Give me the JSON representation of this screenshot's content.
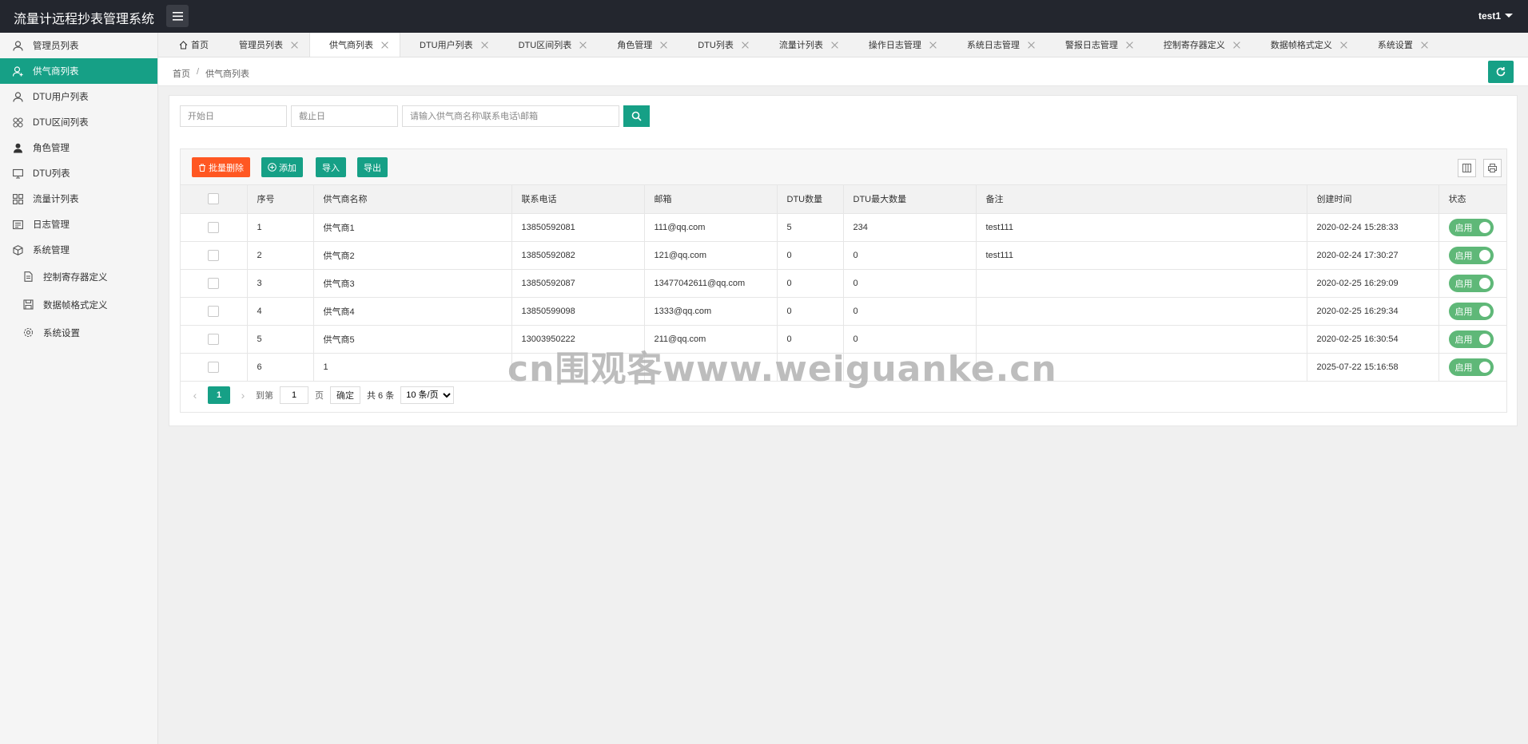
{
  "app": {
    "title": "流量计远程抄表管理系统",
    "user": "test1"
  },
  "sidebar": {
    "items": [
      {
        "label": "管理员列表",
        "icon": "user-icon"
      },
      {
        "label": "供气商列表",
        "icon": "user-add-icon",
        "active": true
      },
      {
        "label": "DTU用户列表",
        "icon": "user-icon"
      },
      {
        "label": "DTU区间列表",
        "icon": "grid-circles-icon"
      },
      {
        "label": "角色管理",
        "icon": "user-solid-icon"
      },
      {
        "label": "DTU列表",
        "icon": "monitor-icon"
      },
      {
        "label": "流量计列表",
        "icon": "apps-icon"
      },
      {
        "label": "日志管理",
        "icon": "log-icon"
      },
      {
        "label": "系统管理",
        "icon": "cube-icon"
      },
      {
        "label": "控制寄存器定义",
        "icon": "file-icon"
      },
      {
        "label": "数据帧格式定义",
        "icon": "save-icon"
      },
      {
        "label": "系统设置",
        "icon": "gear-icon"
      }
    ]
  },
  "tabs": [
    {
      "label": "首页"
    },
    {
      "label": "管理员列表"
    },
    {
      "label": "供气商列表",
      "active": true
    },
    {
      "label": "DTU用户列表"
    },
    {
      "label": "DTU区间列表"
    },
    {
      "label": "角色管理"
    },
    {
      "label": "DTU列表"
    },
    {
      "label": "流量计列表"
    },
    {
      "label": "操作日志管理"
    },
    {
      "label": "系统日志管理"
    },
    {
      "label": "警报日志管理"
    },
    {
      "label": "控制寄存器定义"
    },
    {
      "label": "数据帧格式定义"
    },
    {
      "label": "系统设置"
    }
  ],
  "breadcrumb": {
    "home": "首页",
    "sep": "/",
    "current": "供气商列表"
  },
  "filter": {
    "start_placeholder": "开始日",
    "end_placeholder": "截止日",
    "keyword_placeholder": "请输入供气商名称\\联系电话\\邮箱"
  },
  "toolbar": {
    "batch_delete": "批量删除",
    "add": "添加",
    "import": "导入",
    "export": "导出"
  },
  "table": {
    "headers": [
      "序号",
      "供气商名称",
      "联系电话",
      "邮箱",
      "DTU数量",
      "DTU最大数量",
      "备注",
      "创建时间",
      "状态"
    ],
    "rows": [
      {
        "no": "1",
        "name": "供气商1",
        "phone": "13850592081",
        "email": "111@qq.com",
        "dtu": "5",
        "dtu_max": "234",
        "note": "test111",
        "created": "2020-02-24 15:28:33",
        "status": "启用"
      },
      {
        "no": "2",
        "name": "供气商2",
        "phone": "13850592082",
        "email": "121@qq.com",
        "dtu": "0",
        "dtu_max": "0",
        "note": "test111",
        "created": "2020-02-24 17:30:27",
        "status": "启用"
      },
      {
        "no": "3",
        "name": "供气商3",
        "phone": "13850592087",
        "email": "13477042611@qq.com",
        "dtu": "0",
        "dtu_max": "0",
        "note": "",
        "created": "2020-02-25 16:29:09",
        "status": "启用"
      },
      {
        "no": "4",
        "name": "供气商4",
        "phone": "13850599098",
        "email": "1333@qq.com",
        "dtu": "0",
        "dtu_max": "0",
        "note": "",
        "created": "2020-02-25 16:29:34",
        "status": "启用"
      },
      {
        "no": "5",
        "name": "供气商5",
        "phone": "13003950222",
        "email": "211@qq.com",
        "dtu": "0",
        "dtu_max": "0",
        "note": "",
        "created": "2020-02-25 16:30:54",
        "status": "启用"
      },
      {
        "no": "6",
        "name": "1",
        "phone": "",
        "email": "",
        "dtu": "",
        "dtu_max": "",
        "note": "",
        "created": "2025-07-22 15:16:58",
        "status": "启用"
      }
    ]
  },
  "pager": {
    "current": "1",
    "goto_label": "到第",
    "goto_value": "1",
    "page_unit": "页",
    "confirm": "确定",
    "total": "共 6 条",
    "page_size": "10 条/页"
  },
  "watermark": "cn围观客www.weiguanke.cn",
  "colors": {
    "primary": "#16a086",
    "danger": "#ff5722",
    "switch": "#5fb878",
    "header": "#23262e"
  }
}
